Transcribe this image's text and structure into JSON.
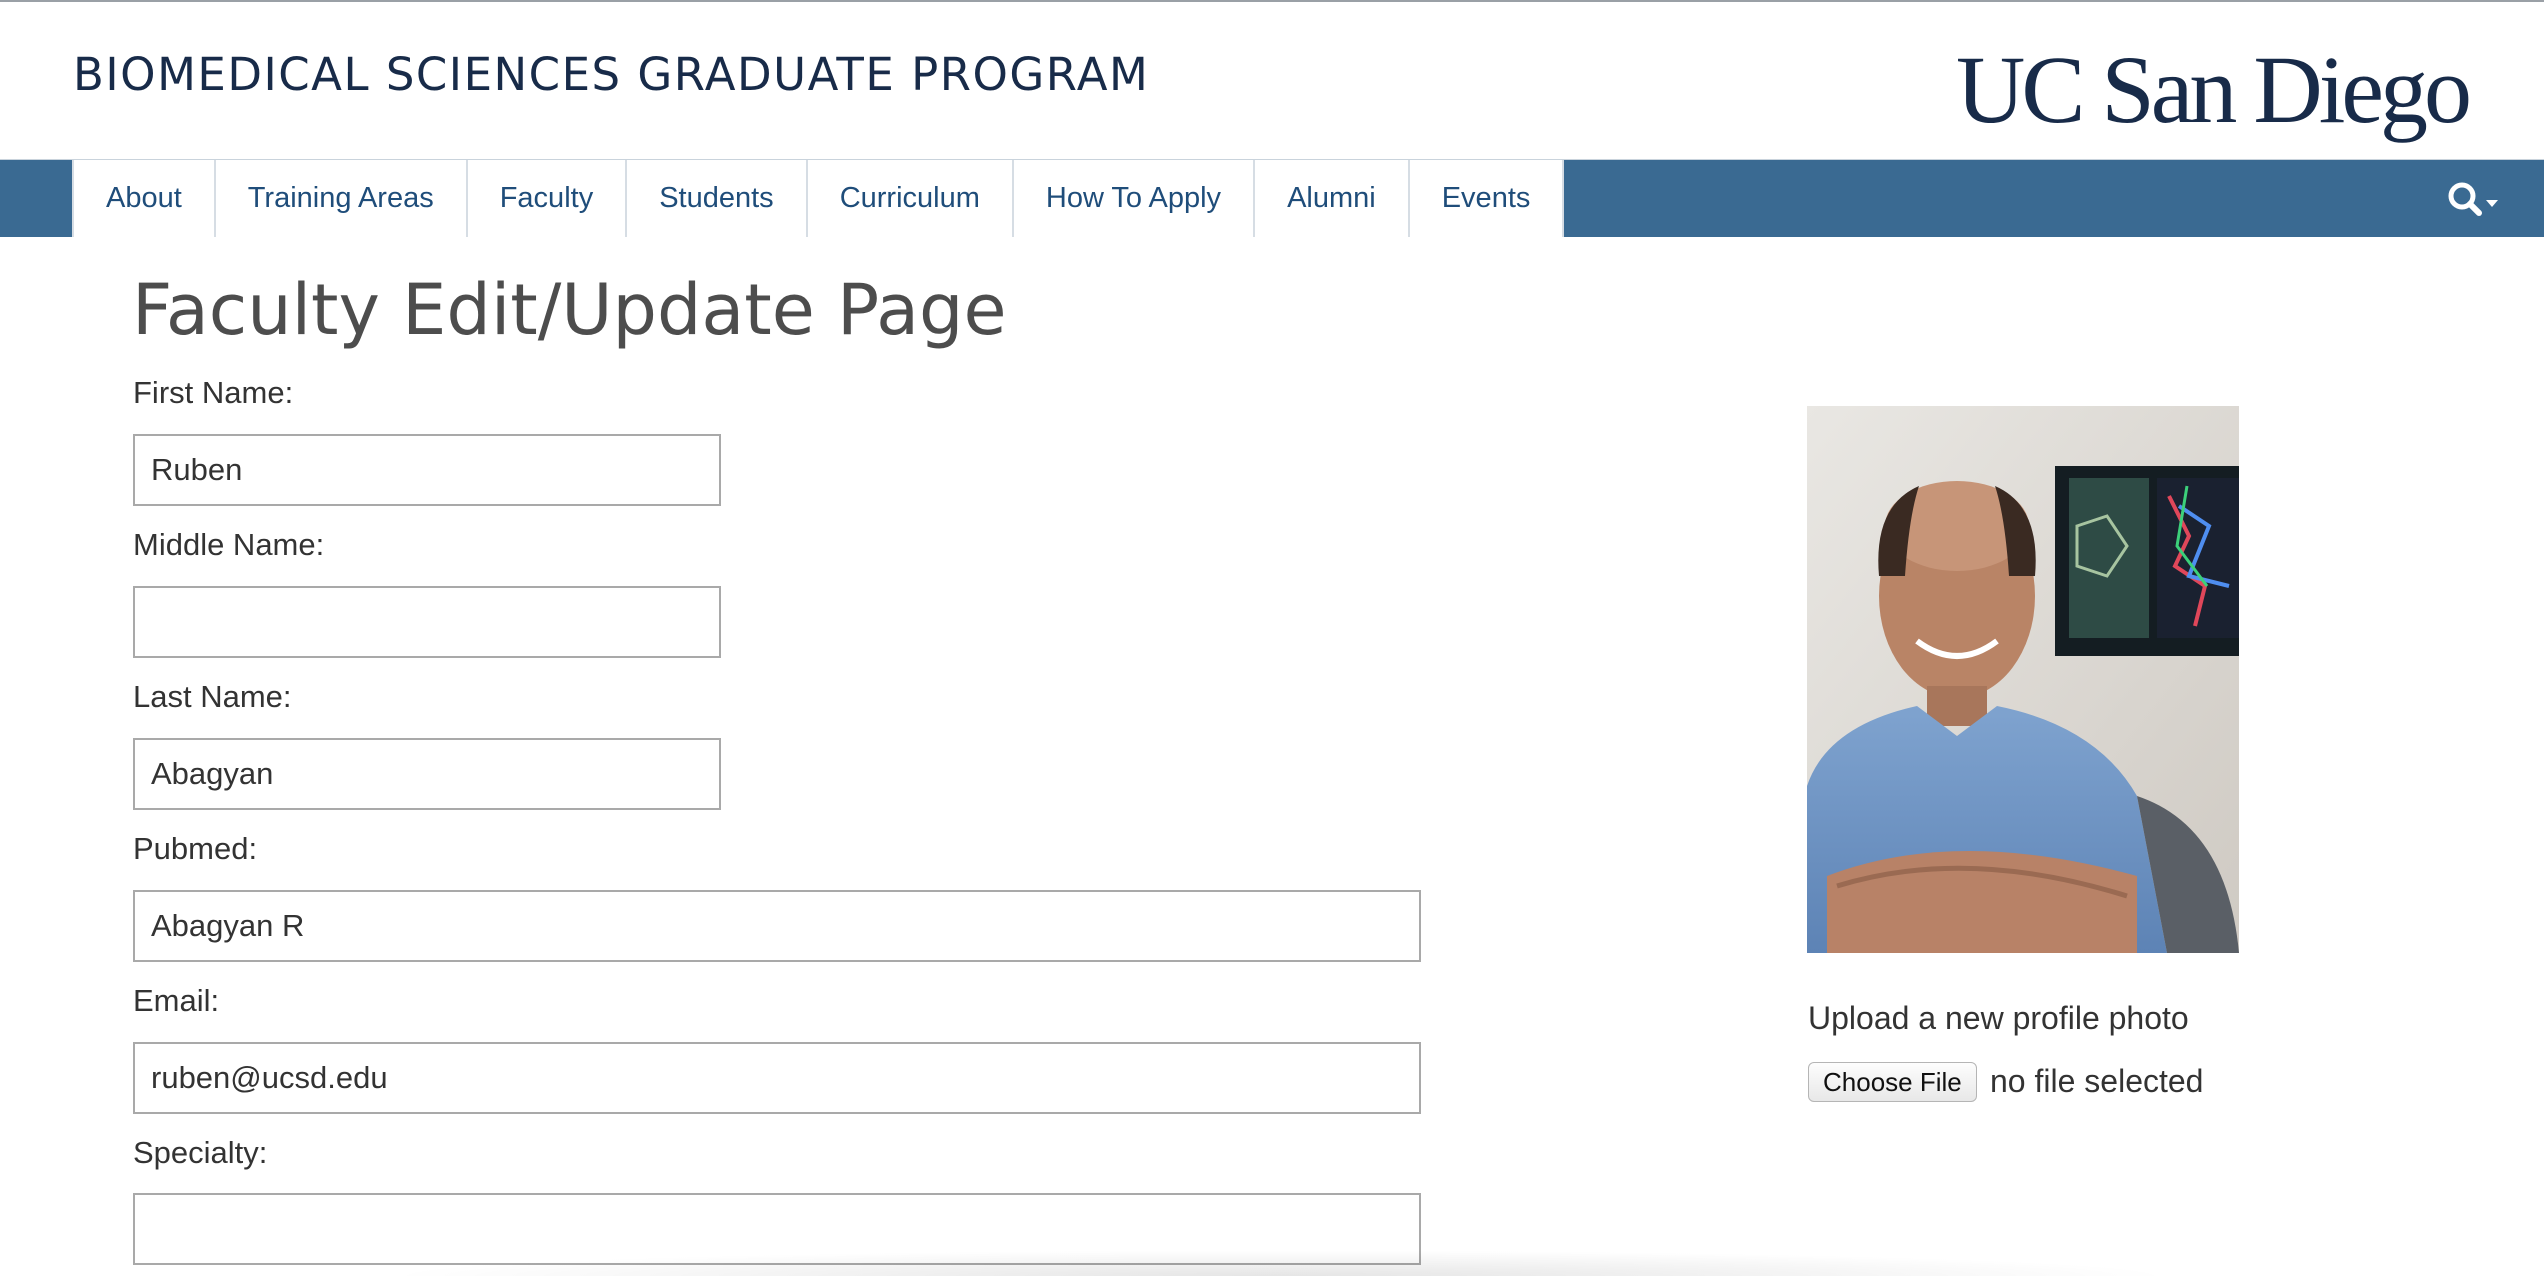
{
  "header": {
    "program_title": "BIOMEDICAL SCIENCES GRADUATE PROGRAM",
    "logo_text": "UC San Diego"
  },
  "nav": {
    "items": [
      {
        "label": "About"
      },
      {
        "label": "Training Areas"
      },
      {
        "label": "Faculty"
      },
      {
        "label": "Students"
      },
      {
        "label": "Curriculum"
      },
      {
        "label": "How To Apply"
      },
      {
        "label": "Alumni"
      },
      {
        "label": "Events"
      }
    ],
    "search_icon": "search-icon"
  },
  "form": {
    "title": "Faculty Edit/Update Page",
    "first_name": {
      "label": "First Name:",
      "value": "Ruben"
    },
    "middle_name": {
      "label": "Middle Name:",
      "value": ""
    },
    "last_name": {
      "label": "Last Name:",
      "value": "Abagyan"
    },
    "pubmed": {
      "label": "Pubmed:",
      "value": "Abagyan R"
    },
    "email": {
      "label": "Email:",
      "value": "ruben@ucsd.edu"
    },
    "specialty": {
      "label": "Specialty:",
      "value": ""
    }
  },
  "profile": {
    "upload_label": "Upload a new profile photo",
    "choose_file_label": "Choose File",
    "file_status": "no file selected"
  },
  "colors": {
    "brand_navy": "#182b49",
    "nav_bar": "#3a6a92",
    "nav_link": "#1f4d7a",
    "title_gray": "#4d4d4d"
  }
}
